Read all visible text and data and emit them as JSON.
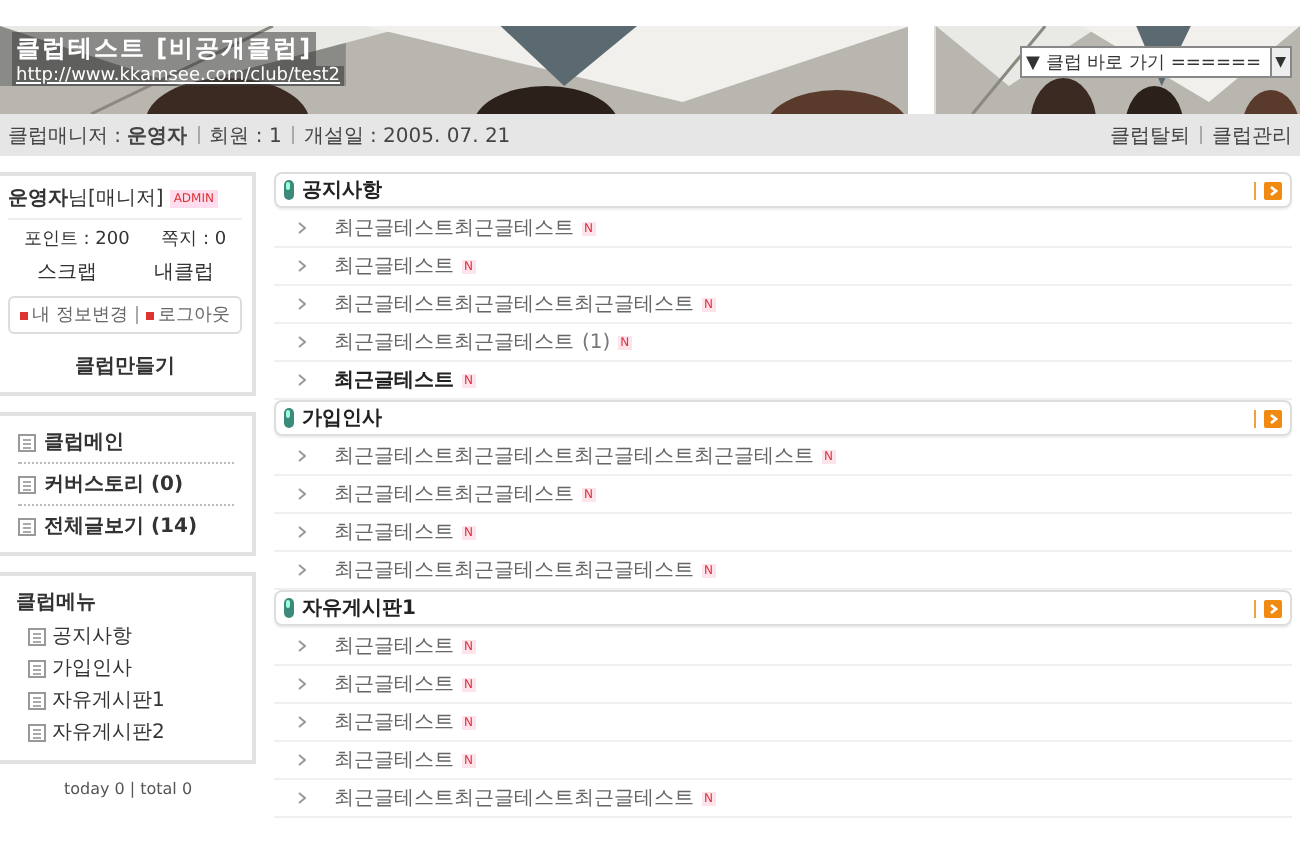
{
  "header": {
    "club_title": "클럽테스트 [비공개클럽]",
    "club_url": "http://www.kkamsee.com/club/test2",
    "jump_select": {
      "value": "▼ 클럽 바로 가기 ======",
      "arrow": "▼"
    }
  },
  "info_bar": {
    "manager_label": "클럽매니저 : ",
    "manager": "운영자",
    "members": "회원 : 1",
    "opened": "개설일 : 2005. 07. 21",
    "links": [
      "클럽탈퇴",
      "클럽관리"
    ]
  },
  "profile": {
    "greeting": "**운영자**님[매니저]",
    "badge": "ADMIN",
    "points": "포인트 : 200",
    "messages": "쪽지 : 0",
    "links": [
      "스크랩",
      "내클럽"
    ],
    "account_links": [
      "내 정보변경",
      "로그아웃"
    ],
    "create": "클럽만들기"
  },
  "main_menu": [
    {
      "label": "클럽메인"
    },
    {
      "label": "커버스토리 (0)"
    },
    {
      "label": "전체글보기 (14)"
    }
  ],
  "club_menu": {
    "title": "클럽메뉴",
    "items": [
      {
        "label": "공지사항"
      },
      {
        "label": "가입인사"
      },
      {
        "label": "자유게시판1"
      },
      {
        "label": "자유게시판2"
      }
    ]
  },
  "counter": "today 0 | total 0",
  "boards": [
    {
      "title": "공지사항",
      "posts": [
        {
          "title": "최근글테스트최근글테스트",
          "badge": "N",
          "bold": false
        },
        {
          "title": "최근글테스트",
          "badge": "N",
          "bold": false
        },
        {
          "title": "최근글테스트최근글테스트최근글테스트",
          "badge": "N",
          "bold": false
        },
        {
          "title": "최근글테스트최근글테스트",
          "comments": "(1)",
          "badge": "N",
          "bold": false
        },
        {
          "title": "최근글테스트",
          "badge": "N",
          "bold": true
        }
      ]
    },
    {
      "title": "가입인사",
      "posts": [
        {
          "title": "최근글테스트최근글테스트최근글테스트최근글테스트",
          "badge": "N",
          "bold": false
        },
        {
          "title": "최근글테스트최근글테스트",
          "badge": "N",
          "bold": false
        },
        {
          "title": "최근글테스트",
          "badge": "N",
          "bold": false
        },
        {
          "title": "최근글테스트최근글테스트최근글테스트",
          "badge": "N",
          "bold": false
        }
      ]
    },
    {
      "title": "자유게시판1",
      "posts": [
        {
          "title": "최근글테스트",
          "badge": "N",
          "bold": false
        },
        {
          "title": "최근글테스트",
          "badge": "N",
          "bold": false
        },
        {
          "title": "최근글테스트",
          "badge": "N",
          "bold": false
        },
        {
          "title": "최근글테스트",
          "badge": "N",
          "bold": false
        },
        {
          "title": "최근글테스트최근글테스트최근글테스트",
          "badge": "N",
          "bold": false
        }
      ]
    }
  ]
}
